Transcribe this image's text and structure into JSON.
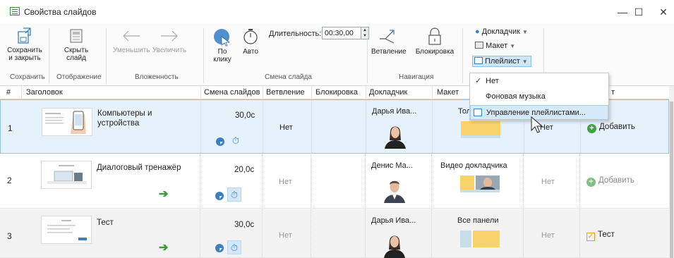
{
  "window": {
    "title": "Свойства слайдов",
    "minimize": "—",
    "maximize": "☐",
    "close": "✕"
  },
  "ribbon": {
    "save_close": {
      "line1": "Сохранить",
      "line2": "и закрыть"
    },
    "hide_slide": {
      "line1": "Скрыть",
      "line2": "слайд"
    },
    "decrease": "Уменьшить",
    "increase": "Увеличить",
    "on_click": {
      "line1": "По",
      "line2": "клику"
    },
    "auto": "Авто",
    "duration_label": "Длительность:",
    "duration_value": "00:30,00",
    "branching": "Ветвление",
    "lock": "Блокировка",
    "presenter": "Докладчик",
    "layout": "Макет",
    "playlist": "Плейлист",
    "groups": {
      "save": "Сохранить",
      "display": "Отображение",
      "nesting": "Вложенность",
      "slide_change": "Смена слайда",
      "navigation": "Навигация"
    }
  },
  "dropdown": {
    "items": [
      "Нет",
      "Фоновая музыка",
      "Управление плейлистами..."
    ],
    "checked_index": 0,
    "highlighted_index": 2
  },
  "table": {
    "headers": [
      "#",
      "Заголовок",
      "Смена слайдов",
      "Ветвление",
      "Блокировка",
      "Докладчик",
      "Макет",
      "т"
    ],
    "rows": [
      {
        "num": "1",
        "title": "Компьютеры и устройства",
        "time": "30,0с",
        "branching": "Нет",
        "presenter": "Дарья Ива...",
        "layout": "Тольк",
        "playlist": "Нет",
        "action": "Добавить"
      },
      {
        "num": "2",
        "title": "Диалоговый тренажёр",
        "time": "20,0с",
        "branching": "Нет",
        "presenter": "Денис Ма...",
        "layout": "Видео докладчика",
        "playlist": "Нет",
        "action": "Добавить"
      },
      {
        "num": "3",
        "title": "Тест",
        "time": "30,0с",
        "branching": "Нет",
        "presenter": "Дарья Ива...",
        "layout": "Все панели",
        "playlist": "Нет",
        "action": "Тест"
      }
    ]
  },
  "colors": {
    "accent": "#3b7fc0",
    "selection": "#e5f1fb",
    "green": "#3fa13f",
    "orange": "#e59a2a"
  }
}
